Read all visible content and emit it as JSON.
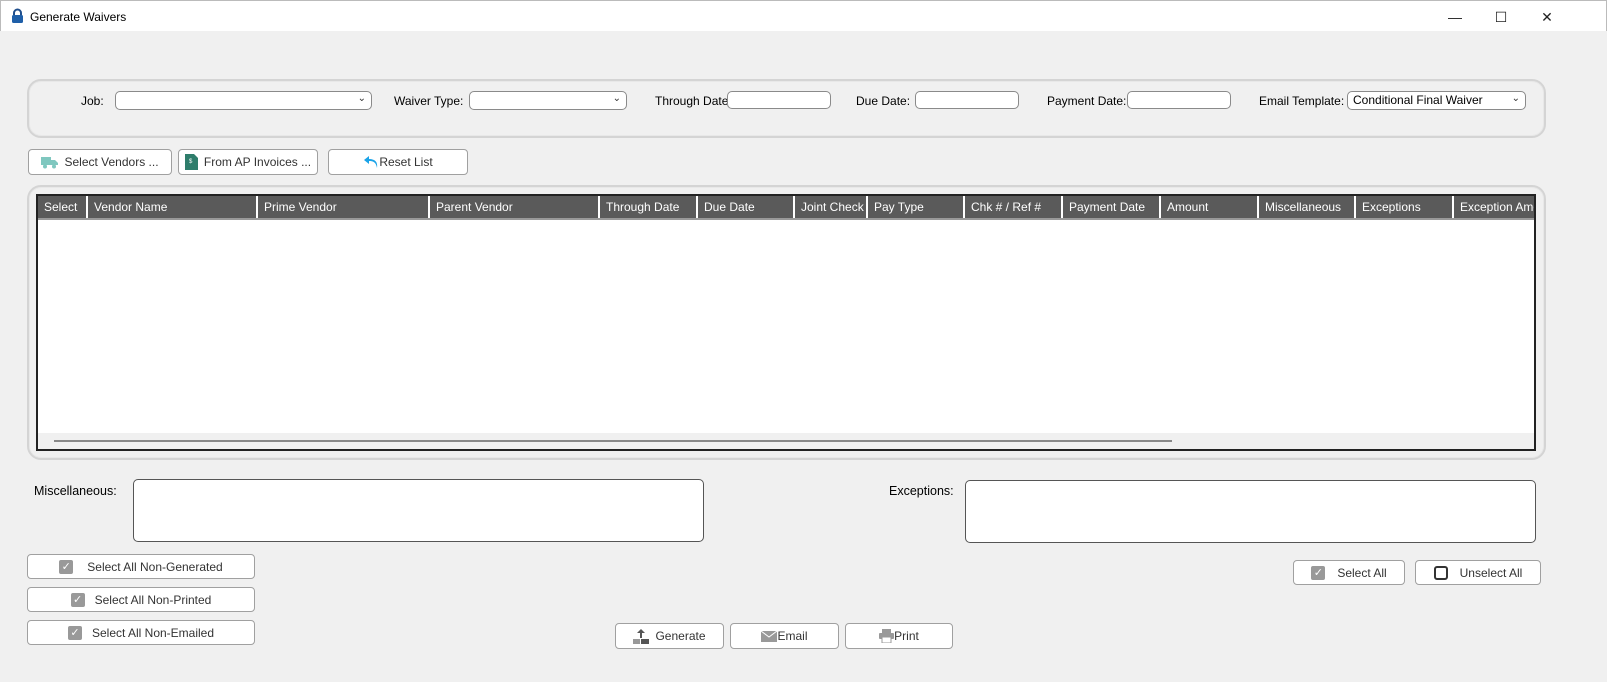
{
  "window": {
    "title": "Generate Waivers",
    "icon": "lock-icon"
  },
  "filters": {
    "job_label": "Job:",
    "job_value": "",
    "waiver_type_label": "Waiver Type:",
    "waiver_type_value": "",
    "through_date_label": "Through Date:",
    "through_date_value": "",
    "due_date_label": "Due Date:",
    "due_date_value": "",
    "payment_date_label": "Payment Date:",
    "payment_date_value": "",
    "email_template_label": "Email Template:",
    "email_template_value": "Conditional Final Waiver"
  },
  "toolbar": {
    "select_vendors": "Select Vendors ...",
    "from_ap_invoices": "From AP Invoices ...",
    "reset_list": "Reset List"
  },
  "grid": {
    "columns": [
      "Select",
      "Vendor Name",
      "Prime Vendor",
      "Parent Vendor",
      "Through Date",
      "Due Date",
      "Joint Check",
      "Pay Type",
      "Chk # / Ref #",
      "Payment Date",
      "Amount",
      "Miscellaneous",
      "Exceptions",
      "Exception Amount"
    ],
    "rows": []
  },
  "notes": {
    "misc_label": "Miscellaneous:",
    "misc_value": "",
    "exceptions_label": "Exceptions:",
    "exceptions_value": ""
  },
  "selection": {
    "non_generated": "Select All Non-Generated",
    "non_printed": "Select All Non-Printed",
    "non_emailed": "Select All Non-Emailed",
    "select_all": "Select All",
    "unselect_all": "Unselect All"
  },
  "actions": {
    "generate": "Generate",
    "email": "Email",
    "print": "Print"
  },
  "colors": {
    "grid_header": "#5a5a5a",
    "reset_arrow": "#1aa3e8",
    "truck": "#7fc7bf",
    "invoice": "#2e7d6b"
  }
}
